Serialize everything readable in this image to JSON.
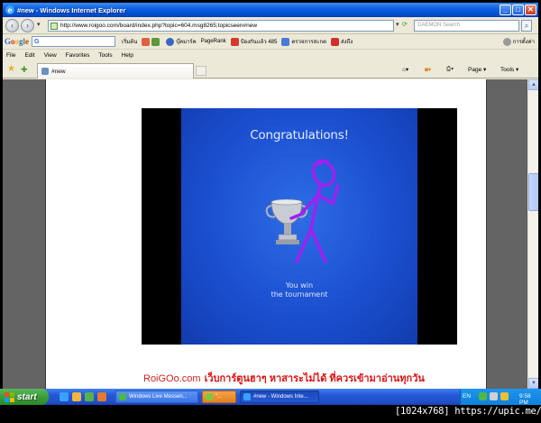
{
  "window": {
    "title": "#new - Windows Internet Explorer",
    "controls": {
      "minimize": "_",
      "maximize": "□",
      "close": "✕"
    }
  },
  "address_bar": {
    "url": "http://www.roigoo.com/board/index.php?topic=604.msg8265;topicseen#new",
    "search_placeholder": "DAEMON Search"
  },
  "google_toolbar": {
    "badge": "G",
    "items": {
      "start": "เริ่มต้น",
      "bookmark": "บุ๊คมาร์ค",
      "pagerank": "PageRank",
      "blocked": "ป้องกันแล้ว 485",
      "spellcheck": "ตรวจการสะกด",
      "send": "ส่งถึง",
      "settings": "การตั้งค่า"
    }
  },
  "menu": [
    "File",
    "Edit",
    "View",
    "Favorites",
    "Tools",
    "Help"
  ],
  "tab": {
    "label": "#new"
  },
  "commands": {
    "page": "Page",
    "tools": "Tools"
  },
  "video": {
    "headline": "Congratulations!",
    "subtitle_line1": "You win",
    "subtitle_line2": "the tournament"
  },
  "footer": {
    "brand": "RoiGOo.com",
    "slogan": "เว็บการ์ตูนฮาๆ หาสาระไม่ได้ ที่ควรเข้ามาอ่านทุกวัน"
  },
  "taskbar": {
    "start": "start",
    "tasks": [
      {
        "label": "Windows Live Messen..."
      },
      {
        "label": "\"..."
      },
      {
        "label": "#new - Windows Inte..."
      }
    ],
    "language": "EN",
    "clock": "9:58 PM"
  },
  "caption": "[1024x768] https://upic.me/",
  "colors": {
    "slide_blue": "#1b4fd0",
    "stick_figure": "#a020f0",
    "brand_red": "#cc2222",
    "taskbar_blue": "#2457d6"
  }
}
